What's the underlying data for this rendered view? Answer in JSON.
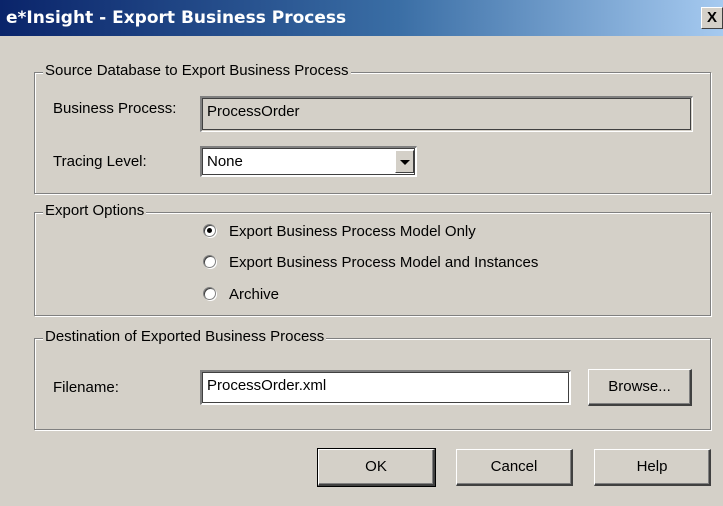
{
  "window": {
    "title": "e*Insight - Export Business Process",
    "close_glyph": "X"
  },
  "source_group": {
    "legend": "Source Database to Export Business Process",
    "business_process_label": "Business Process:",
    "business_process_value": "ProcessOrder",
    "tracing_level_label": "Tracing Level:",
    "tracing_level_value": "None"
  },
  "export_options": {
    "legend": "Export Options",
    "options": [
      {
        "label": "Export Business Process Model Only",
        "selected": true
      },
      {
        "label": "Export Business Process Model and Instances",
        "selected": false
      },
      {
        "label": "Archive",
        "selected": false
      }
    ]
  },
  "destination_group": {
    "legend": "Destination of Exported Business Process",
    "filename_label": "Filename:",
    "filename_value": "ProcessOrder.xml",
    "browse_label": "Browse..."
  },
  "buttons": {
    "ok": "OK",
    "cancel": "Cancel",
    "help": "Help"
  }
}
